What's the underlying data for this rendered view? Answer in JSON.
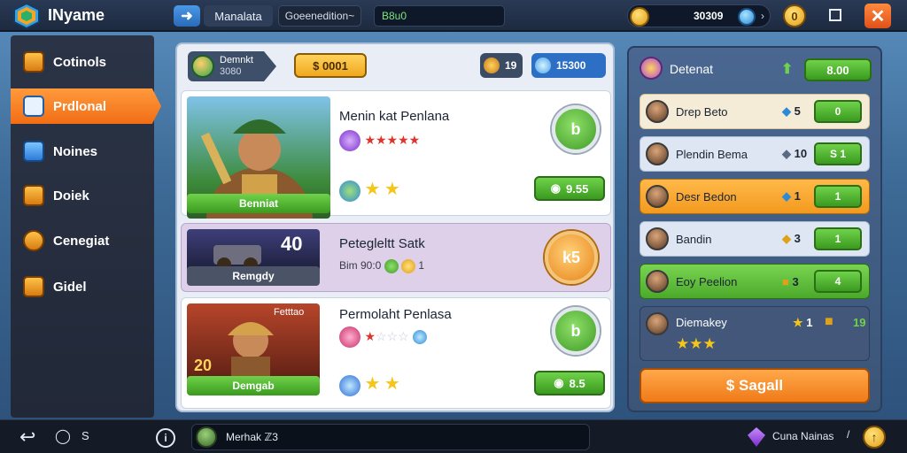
{
  "app": {
    "title": "INyame"
  },
  "topbar": {
    "back_icon": "arrow-left-icon",
    "tab_primary": "Manalata",
    "tab_secondary": "Goeenedition~",
    "search_value": "B8u0",
    "coins": "30309",
    "gold_button": "0",
    "close_icon": "close-icon"
  },
  "sidebar": {
    "items": [
      {
        "label": "Cotinols",
        "icon": "chest-icon"
      },
      {
        "label": "Prdlonal",
        "icon": "chat-icon",
        "active": true
      },
      {
        "label": "Noines",
        "icon": "shield-icon"
      },
      {
        "label": "Doiek",
        "icon": "scroll-icon"
      },
      {
        "label": "Cenegiat",
        "icon": "ring-icon"
      },
      {
        "label": "Gidel",
        "icon": "box-icon"
      }
    ]
  },
  "main": {
    "player": {
      "name": "Demnkt",
      "id": "3080"
    },
    "gold": "$ 0001",
    "resources": [
      {
        "value": "19",
        "icon": "shield-icon"
      },
      {
        "value": "15300",
        "icon": "gem-icon"
      }
    ],
    "cards": [
      {
        "title": "Menin kat Penlana",
        "art_caption": "Benniat",
        "action": "b",
        "price": "9.55",
        "stars": 5
      },
      {
        "title": "Petegleltt Satk",
        "art_caption": "Remgdy",
        "art_number": "40",
        "action": "k5",
        "tags": "Bim 90:0",
        "tag_count": "1"
      },
      {
        "title": "Permolaht Penlasa",
        "art_caption": "Demgab",
        "art_badge": "Fetttao",
        "art_number": "20",
        "action": "b",
        "price": "8.5",
        "stars": 1
      }
    ]
  },
  "right": {
    "title": "Detenat",
    "header_value": "8.00",
    "rows": [
      {
        "name": "Drep Beto",
        "mid": "5",
        "action": "0",
        "style": "cream"
      },
      {
        "name": "Plendin Bema",
        "mid": "10",
        "action": "S 1",
        "style": "blue"
      },
      {
        "name": "Desr Bedon",
        "mid": "1",
        "action": "1",
        "style": "orange"
      },
      {
        "name": "Bandin",
        "mid": "3",
        "action": "1",
        "style": "blue"
      },
      {
        "name": "Eoy Peelion",
        "mid": "3",
        "action": "4",
        "style": "green"
      },
      {
        "name": "Diemakey",
        "mid": "1",
        "extra": "19",
        "stars": 3,
        "style": "slate"
      }
    ],
    "cta": "$ Sagall"
  },
  "bottombar": {
    "chat_count": "S",
    "chat_text": "Merhak ℤ3",
    "player_name": "Cuna Nainas",
    "dropdown": "/"
  }
}
